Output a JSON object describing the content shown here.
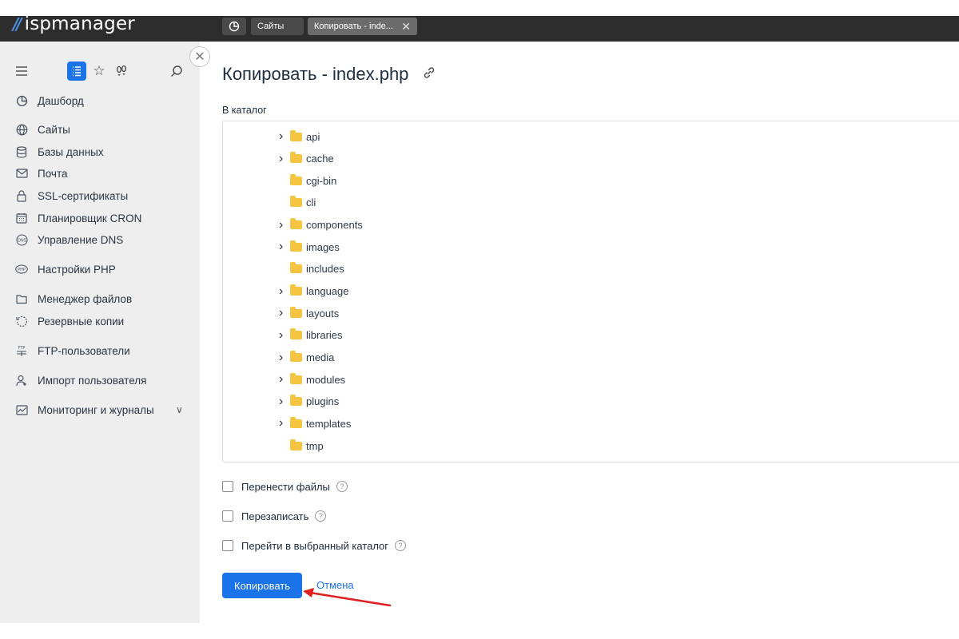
{
  "brand": {
    "name": "ispmanager"
  },
  "tabs": [
    {
      "label": "Сайты"
    },
    {
      "label": "Копировать - inde..."
    }
  ],
  "sidebar": {
    "items": [
      {
        "label": "Дашборд",
        "icon": "dashboard-icon"
      },
      {
        "label": "Сайты",
        "icon": "globe-icon"
      },
      {
        "label": "Базы данных",
        "icon": "database-icon"
      },
      {
        "label": "Почта",
        "icon": "mail-icon"
      },
      {
        "label": "SSL-сертификаты",
        "icon": "lock-icon"
      },
      {
        "label": "Планировщик CRON",
        "icon": "calendar-icon"
      },
      {
        "label": "Управление DNS",
        "icon": "dns-icon"
      },
      {
        "label": "Настройки PHP",
        "icon": "php-icon"
      },
      {
        "label": "Менеджер файлов",
        "icon": "folder-icon"
      },
      {
        "label": "Резервные копии",
        "icon": "backup-icon"
      },
      {
        "label": "FTP-пользователи",
        "icon": "ftp-icon"
      },
      {
        "label": "Импорт пользователя",
        "icon": "user-import-icon"
      },
      {
        "label": "Мониторинг и журналы",
        "icon": "monitoring-icon"
      }
    ]
  },
  "page": {
    "title": "Копировать - index.php",
    "field_label": "В каталог"
  },
  "tree": {
    "folders": [
      {
        "name": "api",
        "expandable": true
      },
      {
        "name": "cache",
        "expandable": true
      },
      {
        "name": "cgi-bin",
        "expandable": false
      },
      {
        "name": "cli",
        "expandable": false
      },
      {
        "name": "components",
        "expandable": true
      },
      {
        "name": "images",
        "expandable": true
      },
      {
        "name": "includes",
        "expandable": false
      },
      {
        "name": "language",
        "expandable": true
      },
      {
        "name": "layouts",
        "expandable": true
      },
      {
        "name": "libraries",
        "expandable": true
      },
      {
        "name": "media",
        "expandable": true
      },
      {
        "name": "modules",
        "expandable": true
      },
      {
        "name": "plugins",
        "expandable": true
      },
      {
        "name": "templates",
        "expandable": true
      },
      {
        "name": "tmp",
        "expandable": false
      }
    ]
  },
  "options": [
    {
      "label": "Перенести файлы",
      "checked": false
    },
    {
      "label": "Перезаписать",
      "checked": false
    },
    {
      "label": "Перейти в выбранный каталог",
      "checked": false
    }
  ],
  "actions": {
    "submit_label": "Копировать",
    "cancel_label": "Отмена"
  },
  "colors": {
    "primary": "#1a73e8",
    "topbar": "#2d2d2d",
    "sidebar": "#eeeeee",
    "folder": "#f5c542",
    "annotation": "#e02020"
  }
}
